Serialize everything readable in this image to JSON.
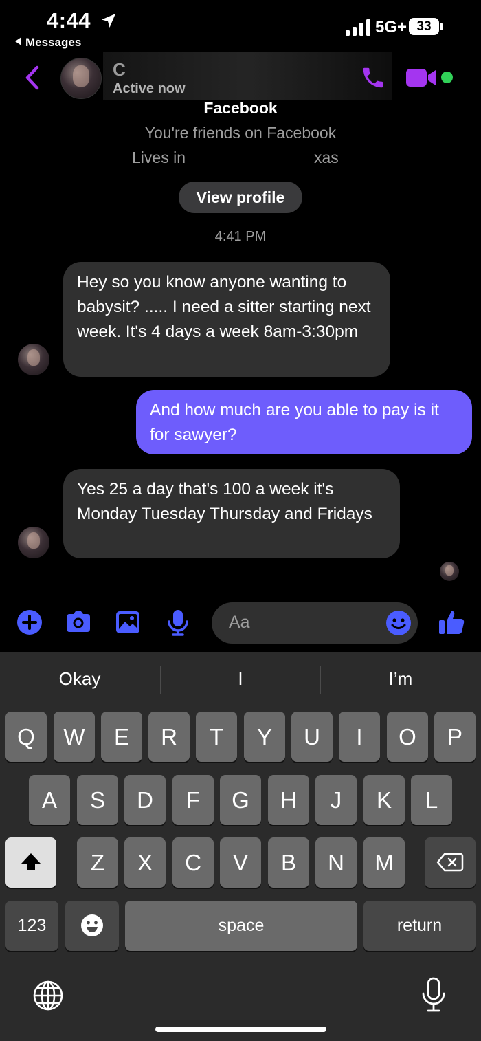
{
  "status_bar": {
    "time": "4:44",
    "back_app": "Messages",
    "network": "5G+",
    "battery": "33"
  },
  "header": {
    "contact_name": "C",
    "status": "Active now"
  },
  "profile": {
    "platform": "Facebook",
    "friends_text": "You're friends on Facebook",
    "lives_prefix": "Lives in",
    "lives_suffix": "xas",
    "view_profile_label": "View profile"
  },
  "conversation": {
    "timestamp": "4:41 PM",
    "messages": [
      {
        "direction": "incoming",
        "text": "Hey so you know anyone wanting to babysit? ..... I need a sitter starting next week. It's 4 days a week 8am-3:30pm"
      },
      {
        "direction": "outgoing",
        "text": "And how much are you able to pay is it for sawyer?"
      },
      {
        "direction": "incoming",
        "text": "Yes 25 a day that's 100 a week it's Monday Tuesday Thursday and Fridays"
      }
    ]
  },
  "composer": {
    "placeholder": "Aa"
  },
  "keyboard": {
    "suggestions": [
      "Okay",
      "I",
      "I’m"
    ],
    "row1": [
      "Q",
      "W",
      "E",
      "R",
      "T",
      "Y",
      "U",
      "I",
      "O",
      "P"
    ],
    "row2": [
      "A",
      "S",
      "D",
      "F",
      "G",
      "H",
      "J",
      "K",
      "L"
    ],
    "row3": [
      "Z",
      "X",
      "C",
      "V",
      "B",
      "N",
      "M"
    ],
    "numbers_label": "123",
    "space_label": "space",
    "return_label": "return"
  },
  "colors": {
    "accent": "#6e5dfc",
    "icon_purple": "#a435f0",
    "icon_blue": "#4a5cff",
    "online_green": "#31d158",
    "incoming_bubble": "#303030"
  },
  "icons": [
    "location-arrow-icon",
    "signal-icon",
    "battery-icon",
    "back-chevron-icon",
    "phone-icon",
    "video-icon",
    "plus-icon",
    "camera-icon",
    "gallery-icon",
    "mic-icon",
    "emoji-icon",
    "thumbs-up-icon",
    "shift-icon",
    "delete-icon",
    "globe-icon",
    "dictation-icon"
  ]
}
